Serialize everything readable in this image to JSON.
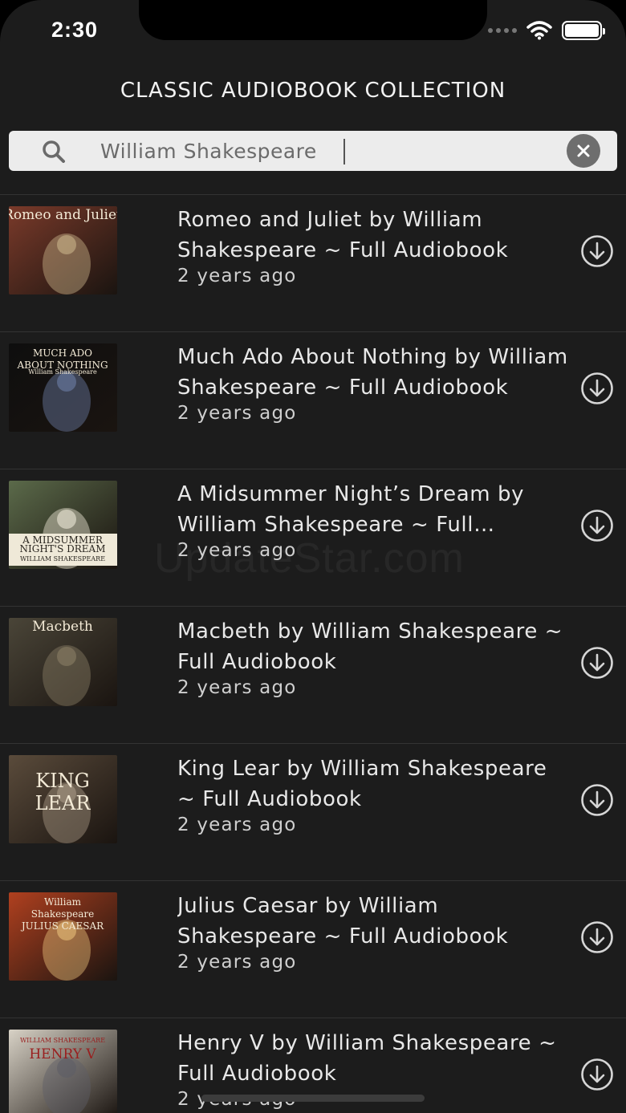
{
  "status_bar": {
    "time": "2:30"
  },
  "header": {
    "title": "CLASSIC AUDIOBOOK COLLECTION"
  },
  "search": {
    "value": "William Shakespeare",
    "icon": "search-icon",
    "clear_icon": "clear-icon"
  },
  "books": [
    {
      "title": "Romeo and Juliet by William Shakespeare ~ Full Audiobook",
      "meta": "2 years ago",
      "cover_text": [
        "Romeo and Juliet"
      ],
      "cover_bg": "#7a3a2a",
      "cover_accent": "#c9b48a"
    },
    {
      "title": "Much Ado About Nothing by William Shakespeare ~ Full Audiobook",
      "meta": "2 years ago",
      "cover_text": [
        "MUCH ADO",
        "ABOUT NOTHING",
        "William Shakespeare"
      ],
      "cover_bg": "#0e0e0e",
      "cover_accent": "#6c7fa6"
    },
    {
      "title": "A Midsummer Night’s Dream by William Shakespeare ~ Full Audiobook",
      "meta": "2 years ago",
      "cover_text": [
        "A MIDSUMMER",
        "NIGHT'S DREAM",
        "WILLIAM SHAKESPEARE"
      ],
      "cover_bg": "#5b6a4a",
      "cover_accent": "#efe9d8"
    },
    {
      "title": "Macbeth by William Shakespeare ~ Full Audiobook",
      "meta": "2 years ago",
      "cover_text": [
        "Macbeth"
      ],
      "cover_bg": "#4a4538",
      "cover_accent": "#8a7e66"
    },
    {
      "title": "King Lear by William Shakespeare ~ Full Audiobook",
      "meta": "2 years ago",
      "cover_text": [
        "KING",
        "LEAR"
      ],
      "cover_bg": "#5a4b3b",
      "cover_accent": "#a89a86"
    },
    {
      "title": "Julius Caesar by William Shakespeare ~ Full Audiobook",
      "meta": "2 years ago",
      "cover_text": [
        "William",
        "Shakespeare",
        "JULIUS CAESAR"
      ],
      "cover_bg": "#b0401f",
      "cover_accent": "#e8c07a"
    },
    {
      "title": "Henry V by William Shakespeare ~ Full Audiobook",
      "meta": "2 years ago",
      "cover_text": [
        "WILLIAM SHAKESPEARE",
        "HENRY V"
      ],
      "cover_bg": "#d8d2c6",
      "cover_accent": "#5e5e66"
    }
  ],
  "watermark": "UpdateStar.com",
  "colors": {
    "background": "#1c1c1c",
    "search_bg": "#ececec",
    "divider": "#333333"
  }
}
